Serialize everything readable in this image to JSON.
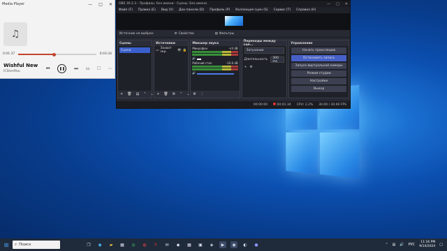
{
  "media_player": {
    "title": "Media Player",
    "position": "0:01:37",
    "duration": "0:03:34",
    "progress": 0.46,
    "song": "Wishful New",
    "artist": "ICShedYou"
  },
  "obs": {
    "title": "OBS 30.2.3 - Профиль: Без имени - Сцены: Без имени",
    "menu": [
      "Файл (F)",
      "Правка (E)",
      "Вид (V)",
      "Док-панели (D)",
      "Профиль (P)",
      "Коллекция сцен (S)",
      "Сервис (T)",
      "Справка (H)"
    ],
    "no_source": "Источник не выбран",
    "properties": "Свойства",
    "filters": "Фильтры",
    "docks": {
      "scenes": "Сцены",
      "sources": "Источники",
      "mixer": "Микшер звука",
      "transitions": "Переходы между сце...",
      "controls": "Управление"
    },
    "scene_item": "Сцена",
    "source_item": "Захват экр.",
    "mixer_rows": [
      {
        "name": "Микрофон",
        "db": "-inf dB"
      },
      {
        "name": "Рабочий стол",
        "db": "-10.6 dB"
      }
    ],
    "transition": "Затухание",
    "duration_label": "Длительность",
    "duration_value": "300 ms",
    "buttons": [
      "Начать трансляцию",
      "Остановить запись",
      "Запуск виртуальной камеры",
      "Режим студии",
      "Настройки",
      "Выход"
    ],
    "status": {
      "rec_time": "00:01:34",
      "cpu": "CPU: 2.2%",
      "fps": "30.00 / 30.00 FPS",
      "stream_time": "00:00:00"
    }
  },
  "taskbar": {
    "search": "Поиск",
    "lang": "РУС",
    "time": "11:16 PM",
    "date": "9/14/2024"
  }
}
